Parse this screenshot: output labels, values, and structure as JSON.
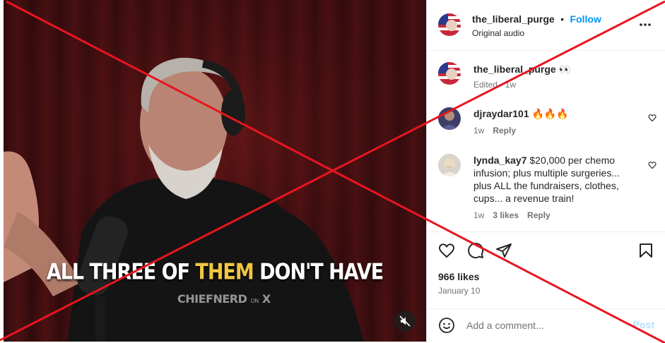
{
  "video": {
    "caption_part1": "ALL THREE OF ",
    "caption_highlight": "THEM",
    "caption_part2": " DON'T HAVE",
    "watermark_main": "CHIEFNERD",
    "watermark_on": "ON",
    "watermark_x": "X",
    "mute_icon": "speaker-muted-icon"
  },
  "header": {
    "username": "the_liberal_purge",
    "separator": "•",
    "follow_label": "Follow",
    "audio_label": "Original audio",
    "more_icon": "more-options-icon"
  },
  "caption_post": {
    "username": "the_liberal_purge",
    "text": "👀",
    "edited": "Edited · 1w"
  },
  "comments": [
    {
      "username": "djraydar101",
      "text": "🔥🔥🔥",
      "time": "1w",
      "likes": "",
      "reply": "Reply"
    },
    {
      "username": "lynda_kay7",
      "text": "$20,000 per chemo infusion; plus multiple surgeries... plus ALL the fundraisers, clothes, cups... a revenue train!",
      "time": "1w",
      "likes": "3 likes",
      "reply": "Reply"
    }
  ],
  "actions": {
    "likes": "966 likes",
    "date": "January 10"
  },
  "add_comment": {
    "placeholder": "Add a comment...",
    "post_label": "Post"
  },
  "colors": {
    "accent": "#0095f6",
    "overlay_red": "#e8151f",
    "caption_highlight": "#f0c640"
  }
}
